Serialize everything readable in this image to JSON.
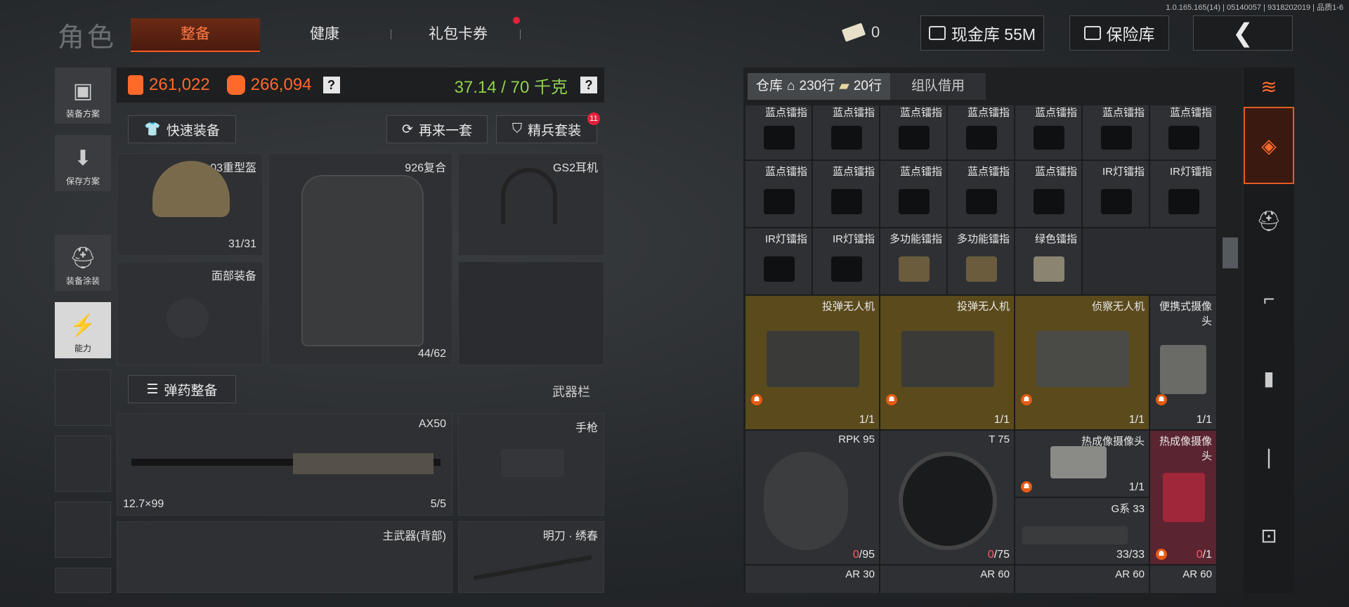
{
  "build_info": "1.0.165.165(14) | 05140057 | 9318202019 | 品质1-6",
  "nav": {
    "role_title": "角色",
    "tabs": [
      {
        "label": "整备",
        "active": true
      },
      {
        "label": "健康",
        "active": false
      },
      {
        "label": "礼包卡券",
        "active": false,
        "has_dot": true
      }
    ]
  },
  "top_right": {
    "tickets": "0",
    "cash_storage": "现金库 55M",
    "safe_box": "保险库"
  },
  "sidebar": {
    "items": [
      {
        "label": "装备方案",
        "icon": "vest-icon"
      },
      {
        "label": "保存方案",
        "icon": "download-icon"
      },
      {
        "label": "装备涂装",
        "icon": "paint-helmet-icon"
      },
      {
        "label": "能力",
        "icon": "lightning-icon",
        "active": true
      }
    ]
  },
  "stats": {
    "value_a": "261,022",
    "value_b": "266,094",
    "weight": "37.14 / 70 千克"
  },
  "actions": {
    "quick_equip": "快速装备",
    "again": "再来一套",
    "elite_set": "精兵套装",
    "elite_badge": "11"
  },
  "equipment": {
    "helmet": {
      "label": "03重型盔",
      "count": "31/31"
    },
    "armor": {
      "label": "926复合",
      "count": "44/62"
    },
    "headset": {
      "label": "GS2耳机"
    },
    "face": {
      "label": "面部装备"
    },
    "ammo_btn": "弹药整备",
    "weapon_bar": "武器栏",
    "rifle": {
      "label": "AX50",
      "caliber": "12.7×99",
      "count": "5/5"
    },
    "pistol": {
      "label": "手枪"
    },
    "primary_back": {
      "label": "主武器(背部)"
    },
    "melee": {
      "label": "明刀 · 绣春"
    }
  },
  "warehouse": {
    "tab_label": "仓库",
    "rows": "230行",
    "rows2": "20行",
    "team_tab": "组队借用",
    "row1_labels": [
      "蓝点镭指",
      "蓝点镭指",
      "蓝点镭指",
      "蓝点镭指",
      "蓝点镭指",
      "蓝点镭指",
      "蓝点镭指"
    ],
    "row2_labels": [
      "蓝点镭指",
      "蓝点镭指",
      "蓝点镭指",
      "蓝点镭指",
      "蓝点镭指",
      "IR灯镭指",
      "IR灯镭指"
    ],
    "row3_labels": [
      "IR灯镭指",
      "IR灯镭指",
      "多功能镭指",
      "多功能镭指",
      "绿色镭指"
    ],
    "drones": [
      {
        "label": "投弹无人机",
        "count": "1/1"
      },
      {
        "label": "投弹无人机",
        "count": "1/1"
      },
      {
        "label": "侦察无人机",
        "count": "1/1"
      },
      {
        "label": "便携式摄像头",
        "count": "1/1"
      }
    ],
    "mags": [
      {
        "label": "RPK 95",
        "cur": "0",
        "max": "/95"
      },
      {
        "label": "T 75",
        "cur": "0",
        "max": "/75"
      },
      {
        "label": "热成像摄像头",
        "count": "1/1"
      },
      {
        "label": "热成像摄像头",
        "cur": "0",
        "max": "/1"
      },
      {
        "label": "G系 33",
        "count": "33/33"
      }
    ],
    "bottom_labels": [
      "AR 30",
      "AR 60",
      "AR 60",
      "AR 60"
    ]
  },
  "colors": {
    "accent": "#ff6a2a",
    "drone_bg": "#5a4a1c",
    "alert": "#ff5a6a"
  }
}
